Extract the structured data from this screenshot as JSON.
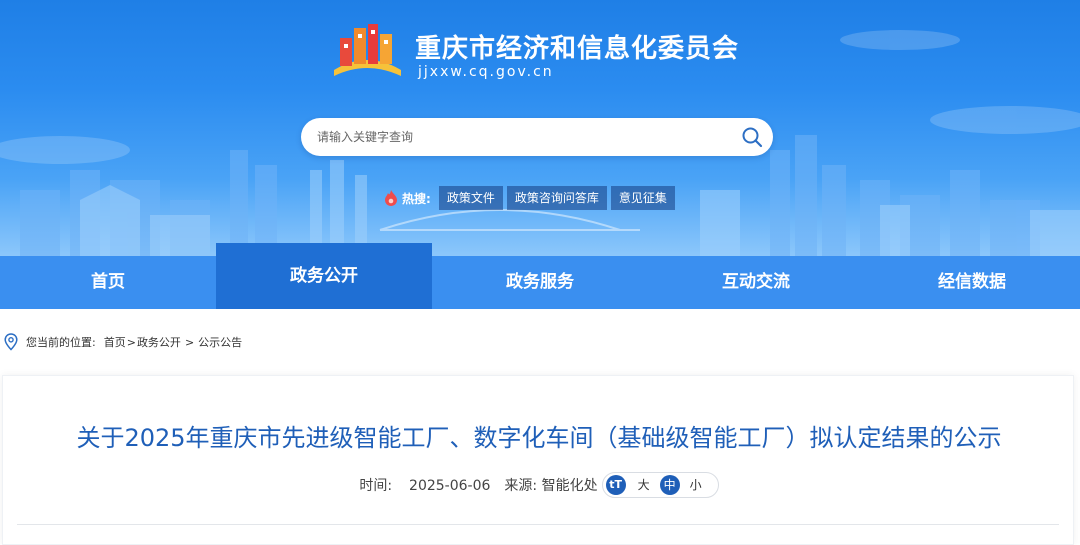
{
  "header": {
    "site_title": "重庆市经济和信息化委员会",
    "site_domain": "jjxxw.cq.gov.cn",
    "logo_icon": "chongqing-building-logo-icon"
  },
  "search": {
    "placeholder": "请输入关键字查询",
    "button_icon": "search-icon"
  },
  "hot_search": {
    "label": "热搜:",
    "icon": "flame-icon",
    "tags": [
      "政策文件",
      "政策咨询问答库",
      "意见征集"
    ]
  },
  "nav": {
    "items": [
      "首页",
      "政务公开",
      "政务服务",
      "互动交流",
      "经信数据"
    ],
    "active": "政务公开"
  },
  "breadcrumb": {
    "icon": "location-pin-icon",
    "prefix": "您当前的位置:",
    "home": "首页",
    "sep1": ">",
    "section": "政务公开",
    "sep2": ">",
    "current": "公示公告"
  },
  "article": {
    "title": "关于2025年重庆市先进级智能工厂、数字化车间（基础级智能工厂）拟认定结果的公示",
    "time_label": "时间:",
    "time_value": "2025-06-06",
    "source_label": "来源:",
    "source_value": "智能化处",
    "font_size_icon_text": "tT",
    "font_sizes": [
      "大",
      "中",
      "小"
    ],
    "font_size_selected": "中"
  },
  "colors": {
    "brand_blue": "#1f6fd4",
    "nav_blue": "#3a8ff0",
    "title_blue": "#1f5fb8"
  }
}
